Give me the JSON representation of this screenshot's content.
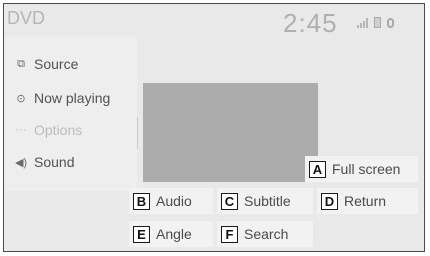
{
  "header": {
    "title": "DVD",
    "clock": "2:45"
  },
  "status_icons": [
    "signal-icon",
    "battery-icon",
    "bluetooth-icon"
  ],
  "sidebar": {
    "items": [
      {
        "label": "Source",
        "icon": "source-icon",
        "enabled": true
      },
      {
        "label": "Now playing",
        "icon": "play-circle-icon",
        "enabled": true
      },
      {
        "label": "Options",
        "icon": "more-icon",
        "enabled": false
      },
      {
        "label": "Sound",
        "icon": "speaker-icon",
        "enabled": true
      }
    ]
  },
  "controls": {
    "full_screen": {
      "letter": "A",
      "label": "Full screen"
    },
    "audio": {
      "letter": "B",
      "label": "Audio"
    },
    "subtitle": {
      "letter": "C",
      "label": "Subtitle"
    },
    "return": {
      "letter": "D",
      "label": "Return"
    },
    "angle": {
      "letter": "E",
      "label": "Angle"
    },
    "search": {
      "letter": "F",
      "label": "Search"
    }
  }
}
